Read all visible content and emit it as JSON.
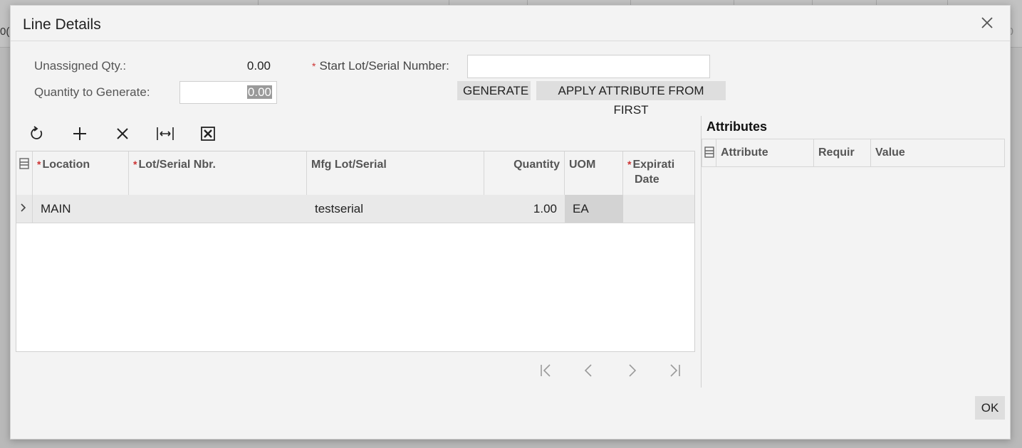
{
  "backdrop": {
    "left_glyph": "0(",
    "right_glyph": "0"
  },
  "dialog": {
    "title": "Line Details",
    "close_icon": "close-icon"
  },
  "form": {
    "unassigned_label": "Unassigned Qty.:",
    "unassigned_value": "0.00",
    "qty_generate_label": "Quantity to Generate:",
    "qty_generate_value": "0.00",
    "start_lot_label": "Start Lot/Serial Number:",
    "start_lot_value": "",
    "required_mark": "*"
  },
  "buttons": {
    "generate": "GENERATE",
    "apply_attribute": "APPLY ATTRIBUTE FROM FIRST",
    "ok": "OK"
  },
  "toolbar": {
    "icons": [
      "refresh-icon",
      "add-icon",
      "delete-icon",
      "fit-columns-icon",
      "export-excel-icon"
    ]
  },
  "grid": {
    "columns": {
      "location": "Location",
      "lot_serial": "Lot/Serial Nbr.",
      "mfg_lot": "Mfg Lot/Serial",
      "quantity": "Quantity",
      "uom": "UOM",
      "expiration_1": "Expirati",
      "expiration_2": "Date"
    },
    "rows": [
      {
        "location": "MAIN",
        "lot_serial": "",
        "mfg_lot": "testserial",
        "quantity": "1.00",
        "uom": "EA",
        "expiration": ""
      }
    ]
  },
  "attributes": {
    "title": "Attributes",
    "columns": {
      "attribute": "Attribute",
      "required": "Requir",
      "value": "Value"
    }
  },
  "colors": {
    "required": "#cc3333",
    "button_bg": "#dedede",
    "dialog_bg": "#f3f3f3"
  }
}
